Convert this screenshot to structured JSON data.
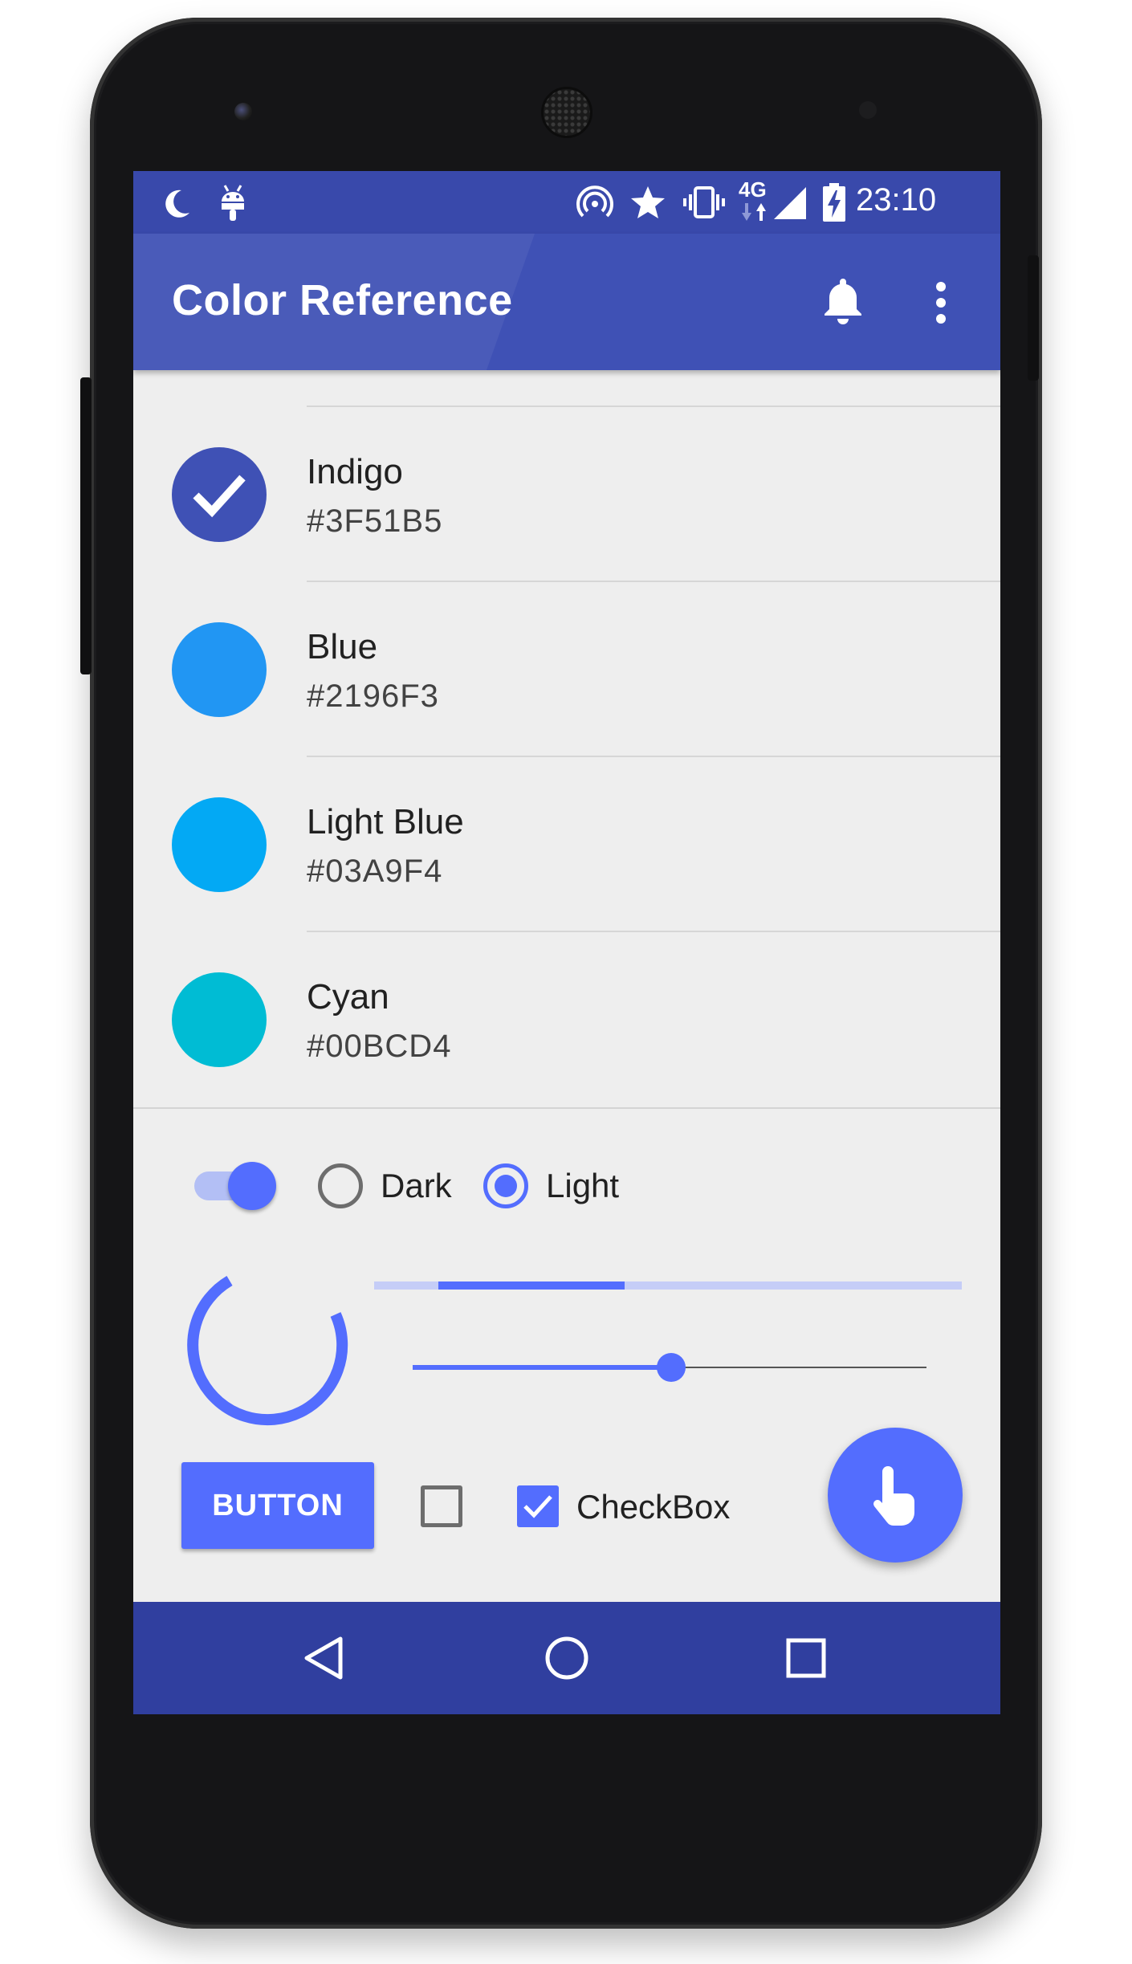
{
  "status_bar": {
    "time": "23:10",
    "network": "4G"
  },
  "app_bar": {
    "title": "Color Reference"
  },
  "colors": [
    {
      "name": "Indigo",
      "hex": "#3F51B5",
      "selected": true
    },
    {
      "name": "Blue",
      "hex": "#2196F3",
      "selected": false
    },
    {
      "name": "Light Blue",
      "hex": "#03A9F4",
      "selected": false
    },
    {
      "name": "Cyan",
      "hex": "#00BCD4",
      "selected": false
    }
  ],
  "controls": {
    "switch_on": true,
    "radio_dark_label": "Dark",
    "radio_light_label": "Light",
    "radio_selected": "Light",
    "slider_value": 0.5,
    "button_label": "BUTTON",
    "checkbox_unchecked": false,
    "checkbox_label": "CheckBox",
    "checkbox_checked": true
  },
  "theme": {
    "primary": "#3f51b5",
    "primary_dark": "#303f9f",
    "accent": "#536dfe",
    "background": "#eeeeee"
  },
  "icons": {
    "status_left": [
      "moon-icon",
      "android-icon"
    ],
    "status_right": [
      "hotspot-icon",
      "star-icon",
      "vibrate-icon",
      "signal-icon",
      "battery-charging-icon"
    ],
    "app_bar": [
      "bell-icon",
      "overflow-menu-icon"
    ],
    "fab": "touch-icon",
    "nav": [
      "back-icon",
      "home-icon",
      "recents-icon"
    ]
  }
}
